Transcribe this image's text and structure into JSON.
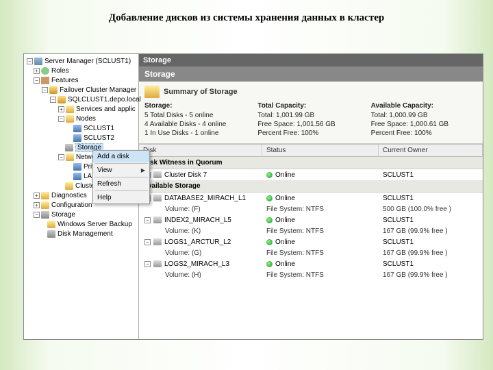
{
  "slide_title": "Добавление дисков из системы хранения данных в кластер",
  "tree": {
    "root": "Server Manager (SCLUST1)",
    "roles": "Roles",
    "features": "Features",
    "fcm": "Failover Cluster Manager",
    "cluster": "SQLCLUST1.depo.local",
    "services": "Services and applic",
    "nodes": "Nodes",
    "node1": "SCLUST1",
    "node2": "SCLUST2",
    "storage": "Storage",
    "networks": "Networks",
    "priv": "Priv",
    "lan": "LAN",
    "clusterev": "Cluster",
    "diagnostics": "Diagnostics",
    "configuration": "Configuration",
    "storage2": "Storage",
    "wsb": "Windows Server Backup",
    "diskmgmt": "Disk Management"
  },
  "ctx": {
    "add": "Add a disk",
    "view": "View",
    "refresh": "Refresh",
    "help": "Help"
  },
  "header": {
    "title": "Storage",
    "subtitle": "Storage"
  },
  "summary": {
    "title": "Summary of Storage",
    "storage_label": "Storage:",
    "storage_l1": "5 Total Disks - 5 online",
    "storage_l2": "4 Available Disks - 4 online",
    "storage_l3": "1 In Use Disks - 1 online",
    "capacity_label": "Total Capacity:",
    "capacity_l1": "Total: 1,001.99 GB",
    "capacity_l2": "Free Space: 1,001.56 GB",
    "capacity_l3": "Percent Free: 100%",
    "avail_label": "Available Capacity:",
    "avail_l1": "Total: 1,000.99 GB",
    "avail_l2": "Free Space: 1,000.61 GB",
    "avail_l3": "Percent Free: 100%"
  },
  "grid": {
    "h_disk": "Disk",
    "h_status": "Status",
    "h_owner": "Current Owner",
    "sec_quorum": "Disk Witness in Quorum",
    "sec_avail": "Available Storage",
    "quorum": {
      "name": "Cluster Disk 7",
      "status": "Online",
      "owner": "SCLUST1"
    },
    "rows": [
      {
        "name": "DATABASE2_MIRACH_L1",
        "status": "Online",
        "owner": "SCLUST1",
        "vol": "Volume: (F)",
        "fs": "File System: NTFS",
        "free": "500 GB (100.0% free )"
      },
      {
        "name": "INDEX2_MIRACH_L5",
        "status": "Online",
        "owner": "SCLUST1",
        "vol": "Volume: (K)",
        "fs": "File System: NTFS",
        "free": "167 GB (99.9% free )"
      },
      {
        "name": "LOGS1_ARCTUR_L2",
        "status": "Online",
        "owner": "SCLUST1",
        "vol": "Volume: (G)",
        "fs": "File System: NTFS",
        "free": "167 GB (99.9% free )"
      },
      {
        "name": "LOGS2_MIRACH_L3",
        "status": "Online",
        "owner": "SCLUST1",
        "vol": "Volume: (H)",
        "fs": "File System: NTFS",
        "free": "167 GB (99.9% free )"
      }
    ]
  }
}
